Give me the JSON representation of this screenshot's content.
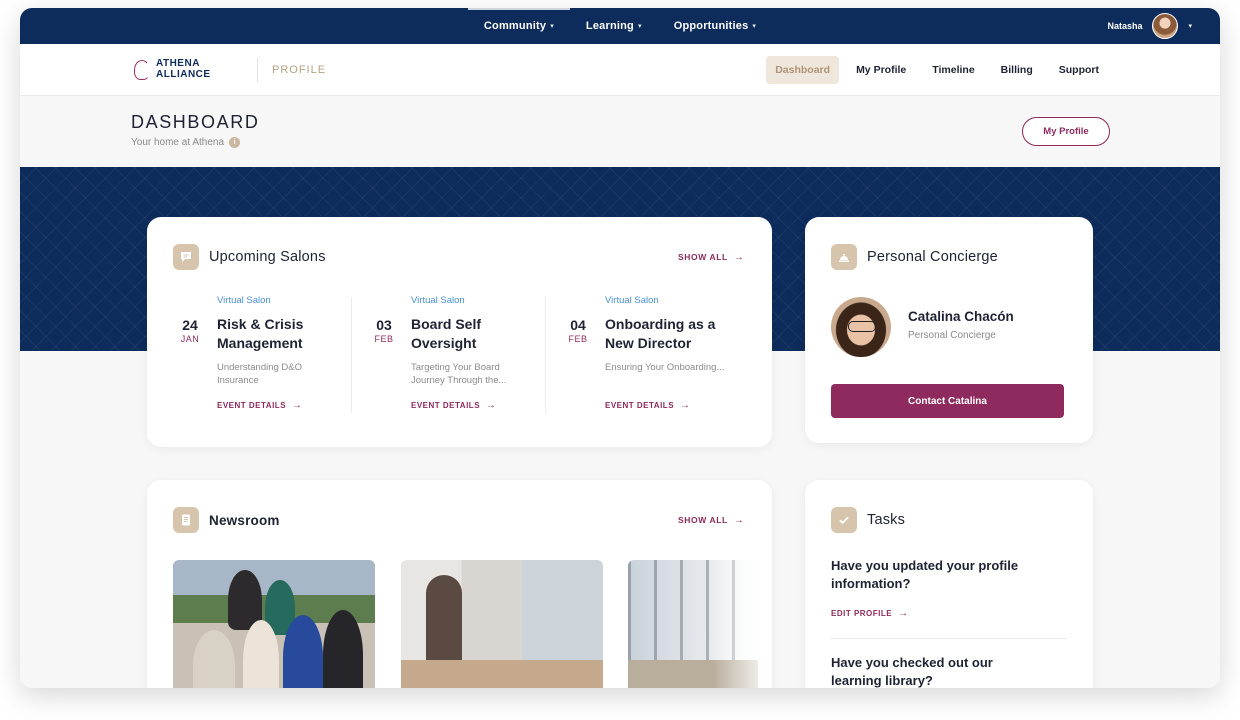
{
  "topnav": {
    "items": [
      {
        "label": "Community",
        "caret": "▾"
      },
      {
        "label": "Learning",
        "caret": "▾"
      },
      {
        "label": "Opportunities",
        "caret": "▾"
      }
    ],
    "user": {
      "name": "Natasha",
      "caret": "▾"
    }
  },
  "brand": {
    "line1": "ATHENA",
    "line2": "ALLIANCE",
    "section": "PROFILE"
  },
  "subnav": {
    "items": [
      {
        "label": "Dashboard",
        "active": true
      },
      {
        "label": "My Profile"
      },
      {
        "label": "Timeline"
      },
      {
        "label": "Billing"
      },
      {
        "label": "Support"
      }
    ]
  },
  "dashboard": {
    "title": "DASHBOARD",
    "subtitle": "Your home at Athena",
    "info_glyph": "i",
    "profile_button": "My Profile"
  },
  "salons": {
    "title": "Upcoming Salons",
    "show_all": "SHOW ALL",
    "arrow": "→",
    "events": [
      {
        "day": "24",
        "month": "JAN",
        "type": "Virtual Salon",
        "title": "Risk & Crisis Management",
        "desc": "Understanding D&O Insurance",
        "details": "EVENT DETAILS"
      },
      {
        "day": "03",
        "month": "FEB",
        "type": "Virtual Salon",
        "title": "Board Self Oversight",
        "desc": "Targeting Your Board Journey Through the...",
        "details": "EVENT DETAILS"
      },
      {
        "day": "04",
        "month": "FEB",
        "type": "Virtual Salon",
        "title": "Onboarding as a New Director",
        "desc": "Ensuring Your Onboarding...",
        "details": "EVENT DETAILS"
      }
    ]
  },
  "concierge": {
    "title": "Personal Concierge",
    "name": "Catalina Chacón",
    "role": "Personal Concierge",
    "button": "Contact Catalina"
  },
  "newsroom": {
    "title": "Newsroom",
    "show_all": "SHOW ALL"
  },
  "tasks": {
    "title": "Tasks",
    "items": [
      {
        "question": "Have you updated your profile information?",
        "link": "EDIT PROFILE"
      },
      {
        "question": "Have you checked out our learning library?"
      }
    ]
  },
  "colors": {
    "navy": "#0d2b5b",
    "plum": "#8e2a5d",
    "tan": "#d6c5ac",
    "link_blue": "#4a8fd6"
  }
}
